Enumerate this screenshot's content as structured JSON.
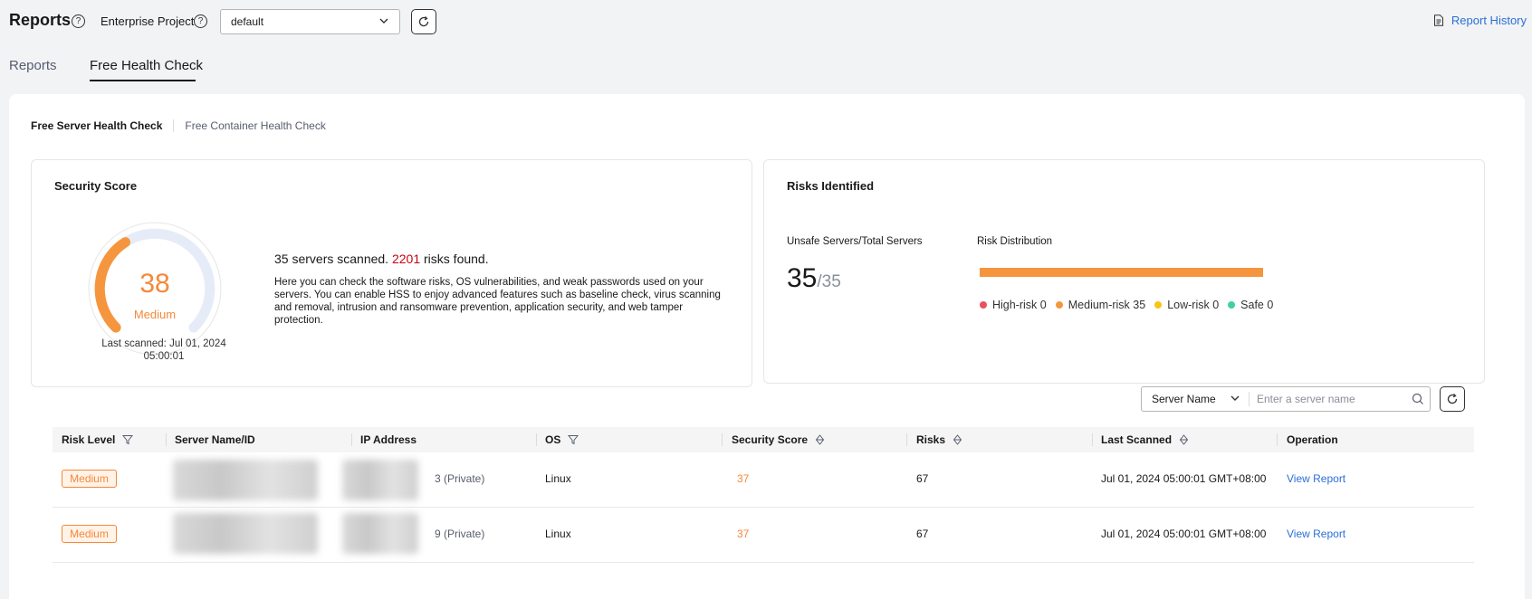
{
  "header": {
    "title": "Reports",
    "enterprise_label": "Enterprise Project",
    "enterprise_value": "default",
    "report_history": "Report History"
  },
  "tabs": [
    {
      "label": "Reports",
      "active": false
    },
    {
      "label": "Free Health Check",
      "active": true
    }
  ],
  "subtabs": [
    {
      "label": "Free Server Health Check",
      "active": true
    },
    {
      "label": "Free Container Health Check",
      "active": false
    }
  ],
  "security_score": {
    "title": "Security Score",
    "score": "38",
    "score_fraction": 0.38,
    "level": "Medium",
    "last_scanned": "Last scanned: Jul 01, 2024 05:00:01",
    "summary_prefix": "35 servers scanned.",
    "risks_count": "2201",
    "summary_suffix": "risks found.",
    "description": "Here you can check the software risks, OS vulnerabilities, and weak passwords used on your servers. You can enable HSS to enjoy advanced features such as baseline check, virus scanning and removal, intrusion and ransomware prevention, application security, and web tamper protection."
  },
  "risks_identified": {
    "title": "Risks Identified",
    "unsafe_label": "Unsafe Servers/Total Servers",
    "unsafe": "35",
    "total": "/35",
    "distribution_label": "Risk Distribution",
    "distribution": [
      {
        "label": "High-risk 0",
        "value": 0,
        "color": "#e9515d"
      },
      {
        "label": "Medium-risk 35",
        "value": 35,
        "color": "#f5963e"
      },
      {
        "label": "Low-risk 0",
        "value": 0,
        "color": "#f9c514"
      },
      {
        "label": "Safe 0",
        "value": 0,
        "color": "#3ed1a1"
      }
    ]
  },
  "search": {
    "type": "Server Name",
    "placeholder": "Enter a server name"
  },
  "table": {
    "columns": [
      "Risk Level",
      "Server Name/ID",
      "IP Address",
      "OS",
      "Security Score",
      "Risks",
      "Last Scanned",
      "Operation"
    ],
    "rows": [
      {
        "risk_level": "Medium",
        "ip_suffix": "3 (Private)",
        "os": "Linux",
        "score": "37",
        "risks": "67",
        "last_scanned": "Jul 01, 2024 05:00:01 GMT+08:00",
        "operation": "View Report"
      },
      {
        "risk_level": "Medium",
        "ip_suffix": "9 (Private)",
        "os": "Linux",
        "score": "37",
        "risks": "67",
        "last_scanned": "Jul 01, 2024 05:00:01 GMT+08:00",
        "operation": "View Report"
      }
    ]
  },
  "colors": {
    "accent": "#f5883a",
    "link": "#2b6fd6",
    "danger": "#c7000b"
  },
  "icons": [
    "help-icon",
    "chevron-down-icon",
    "refresh-icon",
    "document-icon",
    "filter-icon",
    "sort-icon",
    "search-icon"
  ]
}
